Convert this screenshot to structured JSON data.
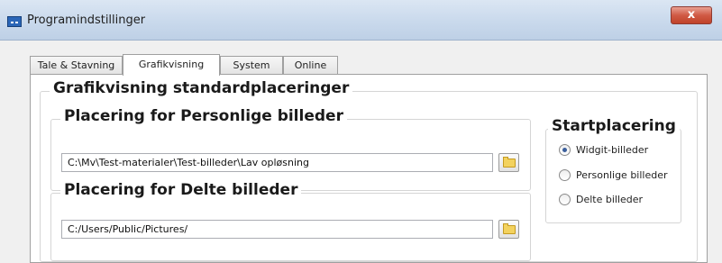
{
  "window": {
    "title": "Programindstillinger",
    "close_label": "x"
  },
  "tabs": [
    {
      "label": "Tale & Stavning",
      "active": false
    },
    {
      "label": "Grafikvisning",
      "active": true
    },
    {
      "label": "System",
      "active": false
    },
    {
      "label": "Online",
      "active": false
    }
  ],
  "main": {
    "section_title": "Grafikvisning standardplaceringer",
    "personal": {
      "label": "Placering for Personlige billeder",
      "value": "C:\\Mv\\Test-materialer\\Test-billeder\\Lav opløsning"
    },
    "shared": {
      "label": "Placering for Delte billeder",
      "value": "C:/Users/Public/Pictures/"
    },
    "start": {
      "label": "Startplacering",
      "options": [
        {
          "label": "Widgit-billeder",
          "checked": true
        },
        {
          "label": "Personlige billeder",
          "checked": false
        },
        {
          "label": "Delte billeder",
          "checked": false
        }
      ]
    }
  },
  "icons": {
    "app": "app-icon",
    "browse": "folder-icon"
  }
}
